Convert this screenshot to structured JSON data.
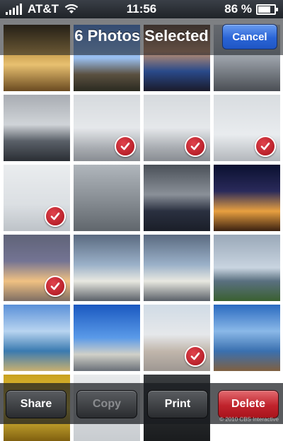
{
  "status_bar": {
    "carrier": "AT&T",
    "time": "11:56",
    "battery": "86 %",
    "battery_level": 0.86
  },
  "nav": {
    "title": "6 Photos Selected",
    "cancel_label": "Cancel",
    "accent": "#2a64d6"
  },
  "toolbar": {
    "share_label": "Share",
    "copy_label": "Copy",
    "print_label": "Print",
    "delete_label": "Delete",
    "delete_color": "#c0232c"
  },
  "photos": [
    {
      "desc": "food dish",
      "selected": false
    },
    {
      "desc": "city skyline",
      "selected": false
    },
    {
      "desc": "two people",
      "selected": false
    },
    {
      "desc": "airport",
      "selected": false
    },
    {
      "desc": "airplane on tarmac",
      "selected": false
    },
    {
      "desc": "runway rain",
      "selected": true
    },
    {
      "desc": "runway rain",
      "selected": true
    },
    {
      "desc": "plane in sky",
      "selected": true
    },
    {
      "desc": "aerial fog",
      "selected": true
    },
    {
      "desc": "aerial city",
      "selected": false
    },
    {
      "desc": "airplane wing",
      "selected": false
    },
    {
      "desc": "city hall night",
      "selected": false
    },
    {
      "desc": "city hall night",
      "selected": true
    },
    {
      "desc": "rainbow skyline",
      "selected": false
    },
    {
      "desc": "rainbow skyline",
      "selected": false
    },
    {
      "desc": "bay bridge",
      "selected": false
    },
    {
      "desc": "beach bay",
      "selected": false
    },
    {
      "desc": "city view",
      "selected": false
    },
    {
      "desc": "city houses",
      "selected": true
    },
    {
      "desc": "golden gate",
      "selected": false
    },
    {
      "desc": "yellow objects",
      "selected": false
    },
    {
      "desc": "screenshot",
      "selected": false
    },
    {
      "desc": "screenshot menu",
      "selected": false
    }
  ],
  "credit": "© 2010 CBS Interactive"
}
